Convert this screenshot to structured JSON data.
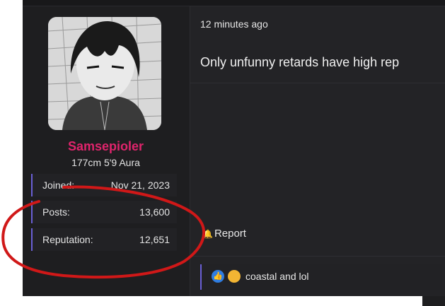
{
  "user": {
    "name": "Samsepioler",
    "title": "177cm 5'9 Aura",
    "stats": [
      {
        "label": "Joined:",
        "value": "Nov 21, 2023"
      },
      {
        "label": "Posts:",
        "value": "13,600"
      },
      {
        "label": "Reputation:",
        "value": "12,651"
      }
    ]
  },
  "post": {
    "timestamp": "12 minutes ago",
    "body": "Only unfunny retards have high rep",
    "report_label": "Report",
    "reactions": {
      "icons": [
        "thumbs-up-icon",
        "thinking-face-icon"
      ],
      "text": "coastal and lol"
    }
  },
  "colors": {
    "username": "#e0246c",
    "accent_bar": "#6a5fd6",
    "annotation": "#d01818"
  }
}
